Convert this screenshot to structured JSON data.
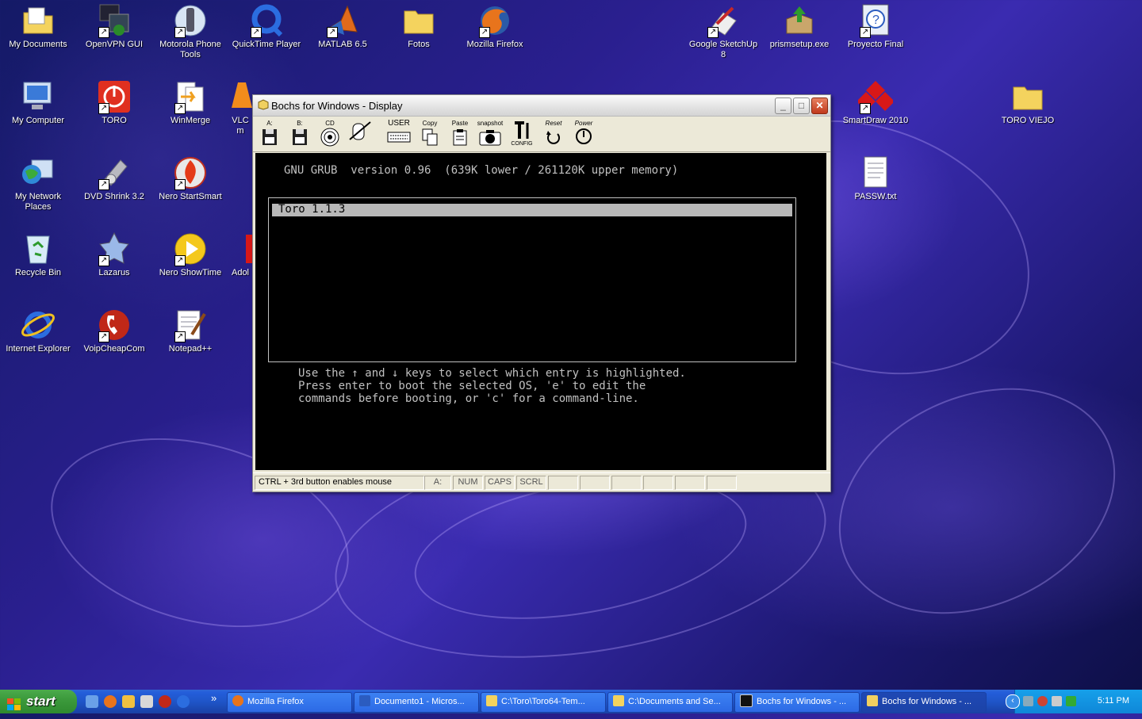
{
  "desktop": {
    "icons": [
      {
        "label": "My Documents"
      },
      {
        "label": "OpenVPN GUI"
      },
      {
        "label": "Motorola Phone Tools"
      },
      {
        "label": "QuickTime Player"
      },
      {
        "label": "MATLAB 6.5"
      },
      {
        "label": "Fotos"
      },
      {
        "label": "Mozilla Firefox"
      },
      {
        "label": "Google SketchUp 8"
      },
      {
        "label": "prismsetup.exe"
      },
      {
        "label": "Proyecto Final"
      },
      {
        "label": "My Computer"
      },
      {
        "label": "TORO"
      },
      {
        "label": "WinMerge"
      },
      {
        "label": "VLC m"
      },
      {
        "label": "SmartDraw 2010"
      },
      {
        "label": "TORO VIEJO"
      },
      {
        "label": "My Network Places"
      },
      {
        "label": "DVD Shrink 3.2"
      },
      {
        "label": "Nero StartSmart"
      },
      {
        "label": "PASSW.txt"
      },
      {
        "label": "Recycle Bin"
      },
      {
        "label": "Lazarus"
      },
      {
        "label": "Nero ShowTime"
      },
      {
        "label": "Adol"
      },
      {
        "label": "Internet Explorer"
      },
      {
        "label": "VoipCheapCom"
      },
      {
        "label": "Notepad++"
      }
    ]
  },
  "window": {
    "title": "Bochs for Windows - Display",
    "controls": {
      "minimize": "_",
      "maximize": "□",
      "close": "✕"
    },
    "toolbar": {
      "a": "A:",
      "b": "B:",
      "cd": "CD",
      "user": "USER",
      "copy": "Copy",
      "paste": "Paste",
      "snapshot": "snapshot",
      "config": "CONFIG",
      "reset": "Reset",
      "power": "Power"
    },
    "screen": {
      "header": "GNU GRUB  version 0.96  (639K lower / 261120K upper memory)",
      "menu_entry": "Toro 1.1.3",
      "help_lines": [
        "Use the ↑ and ↓ keys to select which entry is highlighted.",
        "Press enter to boot the selected OS, 'e' to edit the",
        "commands before booting, or 'c' for a command-line."
      ]
    },
    "status": {
      "mouse_hint": "CTRL + 3rd button enables mouse",
      "drive": "A:",
      "num": "NUM",
      "caps": "CAPS",
      "scrl": "SCRL"
    }
  },
  "taskbar": {
    "start_label": "start",
    "overflow": "»",
    "tasks": [
      {
        "label": "Mozilla Firefox",
        "icon": "firefox-icon"
      },
      {
        "label": "Documento1 - Micros...",
        "icon": "word-icon"
      },
      {
        "label": "C:\\Toro\\Toro64-Tem...",
        "icon": "folder-icon"
      },
      {
        "label": "C:\\Documents and Se...",
        "icon": "folder-icon"
      },
      {
        "label": "Bochs for Windows - ...",
        "icon": "console-icon"
      },
      {
        "label": "Bochs for Windows - ...",
        "icon": "bochs-icon"
      }
    ],
    "clock": "5:11 PM",
    "tray_toggle": "‹"
  }
}
